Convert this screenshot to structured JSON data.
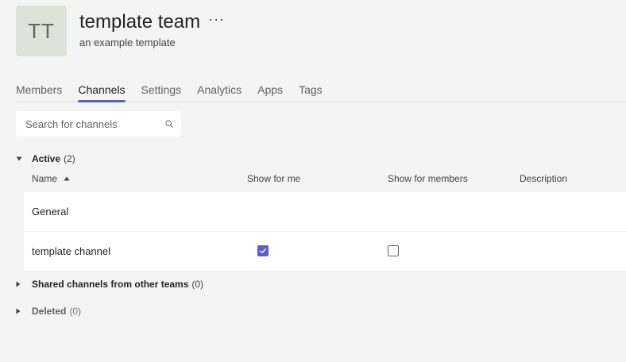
{
  "team": {
    "initials": "TT",
    "name": "template team",
    "more_icon": "···",
    "description": "an example template",
    "avatar_color": "#dde3d8"
  },
  "tabs": [
    {
      "label": "Members",
      "active": false
    },
    {
      "label": "Channels",
      "active": true
    },
    {
      "label": "Settings",
      "active": false
    },
    {
      "label": "Analytics",
      "active": false
    },
    {
      "label": "Apps",
      "active": false
    },
    {
      "label": "Tags",
      "active": false
    }
  ],
  "search": {
    "placeholder": "Search for channels",
    "value": ""
  },
  "sections": {
    "active": {
      "title": "Active",
      "count": "(2)",
      "expanded": true
    },
    "shared": {
      "title": "Shared channels from other teams",
      "count": "(0)",
      "expanded": false
    },
    "deleted": {
      "title": "Deleted",
      "count": "(0)",
      "expanded": false
    }
  },
  "columns": {
    "name": "Name",
    "show_for_me": "Show for me",
    "show_for_members": "Show for members",
    "description": "Description"
  },
  "channels": [
    {
      "name": "General",
      "show_for_me": null,
      "show_for_members": null,
      "description": ""
    },
    {
      "name": "template channel",
      "show_for_me": true,
      "show_for_members": false,
      "description": ""
    }
  ],
  "colors": {
    "accent": "#5b5fc7",
    "background": "#f4f4f4",
    "row_background": "#ffffff"
  }
}
